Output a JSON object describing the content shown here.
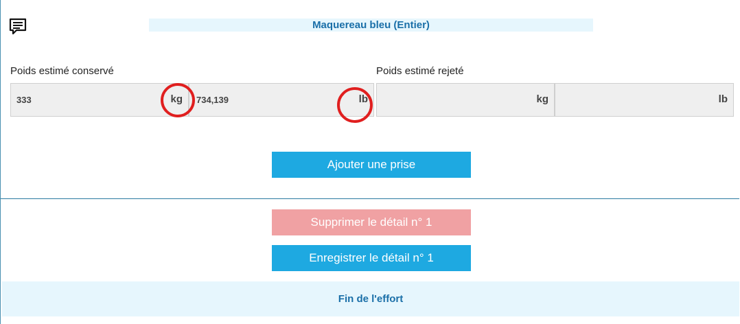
{
  "header": {
    "species_title": "Maquereau bleu (Entier)",
    "comment_icon": "comment-icon"
  },
  "kept": {
    "label": "Poids estimé conservé",
    "kg_value": "333",
    "kg_unit": "kg",
    "lb_value": "734,139",
    "lb_unit": "lb"
  },
  "rejected": {
    "label": "Poids estimé rejeté",
    "kg_value": "",
    "kg_unit": "kg",
    "lb_value": "",
    "lb_unit": "lb"
  },
  "actions": {
    "add_catch": "Ajouter une prise",
    "delete_detail": "Supprimer le détail n° 1",
    "save_detail": "Enregistrer le détail n° 1",
    "end_effort": "Fin de l'effort"
  },
  "colors": {
    "accent": "#1ea9e1",
    "danger_disabled": "#f0a1a3",
    "title_bg": "#e6f6fd",
    "title_text": "#1a6fa8",
    "highlight_circle": "#e01f1f"
  }
}
